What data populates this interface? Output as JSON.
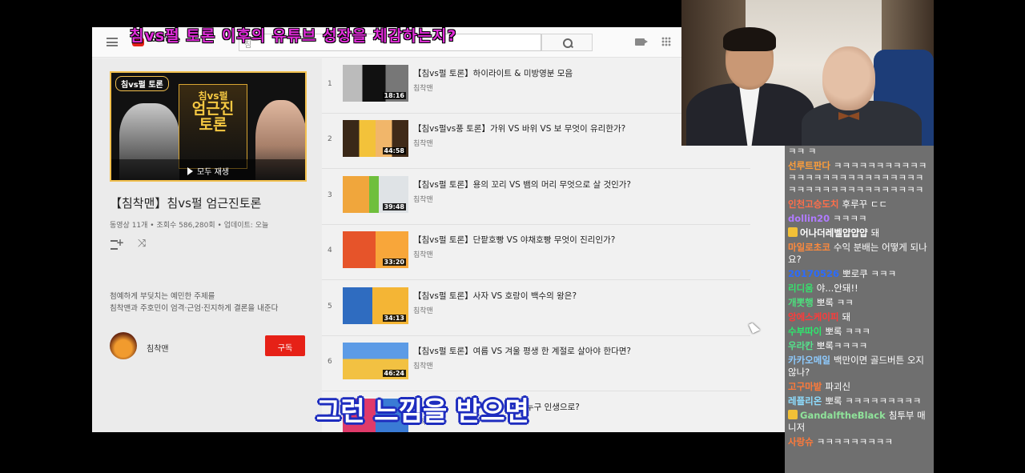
{
  "youtube": {
    "logo": "YouTube",
    "search_placeholder": "침",
    "playlist": {
      "thumb_tag": "침vs펄 토론",
      "thumb_center_line1": "침vs펄",
      "thumb_center_line2": "엄근진",
      "thumb_center_line3": "토론",
      "play_all": "모두 재생",
      "title": "【침착맨】침vs펄 엄근진토론",
      "meta": "동영상 11개 • 조회수 586,280회 • 업데이트: 오늘",
      "desc_line1": "첨예하게 부딪치는 예민한 주제를",
      "desc_line2": "침착맨과 주호민이 엄격·근엄·진지하게 결론을 내준다",
      "channel": "침착맨",
      "subscribe": "구독"
    },
    "videos": [
      {
        "idx": "1",
        "title": "【침vs펄 토론】하이라이트 & 미방영분 모음",
        "channel": "침착맨",
        "duration": "18:16"
      },
      {
        "idx": "2",
        "title": "【침vs펄vs풍 토론】가위 VS 바위 VS 보 무엇이 유리한가?",
        "channel": "침착맨",
        "duration": "44:58"
      },
      {
        "idx": "3",
        "title": "【침vs펄 토론】용의 꼬리 VS 뱀의 머리 무엇으로 살 것인가?",
        "channel": "침착맨",
        "duration": "39:48"
      },
      {
        "idx": "4",
        "title": "【침vs펄 토론】단팥호빵 VS 야채호빵 무엇이 진리인가?",
        "channel": "침착맨",
        "duration": "33:20"
      },
      {
        "idx": "5",
        "title": "【침vs펄 토론】사자 VS 호랑이 백수의 왕은?",
        "channel": "침착맨",
        "duration": "34:13"
      },
      {
        "idx": "6",
        "title": "【침vs펄 토론】여름 VS 겨울 평생 한 계절로 살아야 한다면?",
        "channel": "침착맨",
        "duration": "46:24"
      },
      {
        "idx": "7",
        "title": "면 누구 인생으로?",
        "channel": "침착맨",
        "duration": ""
      }
    ]
  },
  "overlay": {
    "top_caption": "침vs펄 토론 이후의 유튜브 성장을 체감하는지?",
    "subtitle": "그런 느낌을 받으면"
  },
  "chat": [
    {
      "nick": "",
      "text": "ㅋㅋ ㅋ",
      "color": "#ffffff"
    },
    {
      "nick": "선루트판다",
      "text": "ㅋㅋㅋㅋㅋㅋㅋㅋㅋㅋㅋㅋㅋㅋㅋㅋㅋㅋㅋㅋㅋㅋㅋㅋㅋㅋㅋㅋㅋㅋㅋㅋㅋㅋㅋㅋㅋㅋㅋㅋㅋㅋㅋ",
      "color": "#ff9e3a"
    },
    {
      "nick": "인천고승도치",
      "text": "후루꾸 ㄷㄷ",
      "color": "#ff6e4a"
    },
    {
      "nick": "dollin20",
      "text": "ㅋㅋㅋㅋ",
      "color": "#b07bff"
    },
    {
      "nick": "어나더레벨얍얍얍",
      "text": "돼",
      "color": "#ffffff",
      "badge": true
    },
    {
      "nick": "마일로초코",
      "text": "수익 분배는 어떻게 되나요?",
      "color": "#ff8a3c"
    },
    {
      "nick": "20170526",
      "text": "뽀로쿠 ㅋㅋㅋ",
      "color": "#2b6bff"
    },
    {
      "nick": "리디움",
      "text": "야...안돼!!",
      "color": "#37e06e"
    },
    {
      "nick": "개뽓행",
      "text": "뽀록 ㅋㅋ",
      "color": "#4ce07d"
    },
    {
      "nick": "앙에스케이피",
      "text": "돼",
      "color": "#ff3a3a"
    },
    {
      "nick": "수부따이",
      "text": "뽀록 ㅋㅋㅋ",
      "color": "#2ee86d"
    },
    {
      "nick": "우라칸",
      "text": "뽀록ㅋㅋㅋㅋ",
      "color": "#54e38c"
    },
    {
      "nick": "카카오메일",
      "text": "백만이면 골드버튼 오지않나?",
      "color": "#8ecbff"
    },
    {
      "nick": "고구마밭",
      "text": "파괴신",
      "color": "#ff7a3a"
    },
    {
      "nick": "레플리온",
      "text": "뽀록 ㅋㅋㅋㅋㅋㅋㅋㅋㅋ",
      "color": "#8eddff"
    },
    {
      "nick": "GandalftheBlack",
      "text": "침투부 매니저",
      "color": "#8fe39a",
      "badge": true
    },
    {
      "nick": "사랑슈",
      "text": "ㅋㅋㅋㅋㅋㅋㅋㅋㅋ",
      "color": "#ff7a3a"
    }
  ]
}
